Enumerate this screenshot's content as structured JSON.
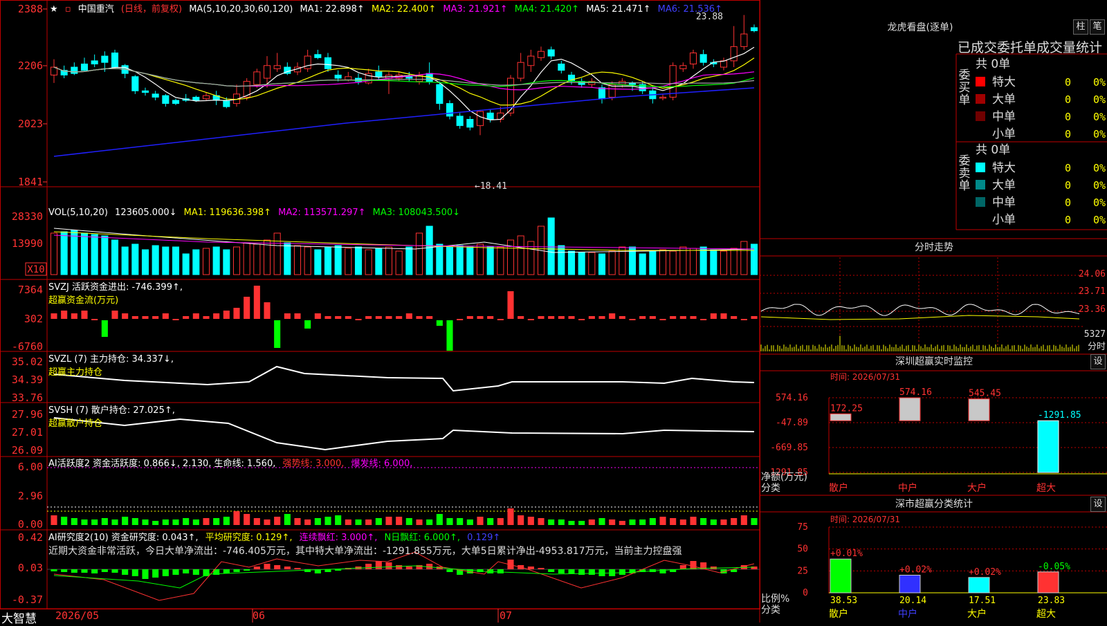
{
  "colors": {
    "up": "#ff3232",
    "down": "#00ffff",
    "ma1": "#ffffff",
    "ma2": "#ffff00",
    "ma3": "#ff00ff",
    "ma4": "#00ff00",
    "ma5": "#aaaaaa",
    "ma6": "#2020ff"
  },
  "header": {
    "stock_name": "中国重汽",
    "mode": "(日线，前复权)",
    "ma_params": "MA(5,10,20,30,60,120)",
    "ma1": "MA1: 22.898↑",
    "ma2": "MA2: 22.400↑",
    "ma3": "MA3: 21.921↑",
    "ma4": "MA4: 21.420↑",
    "ma5": "MA5: 21.471↑",
    "ma6": "MA6: 21.536↑"
  },
  "price_axis": [
    "2388",
    "2206",
    "2023",
    "1841"
  ],
  "price_high_label": "23.88",
  "price_low_label": "←18.41",
  "vol": {
    "title": "VOL(5,10,20)",
    "value": "123605.000↓",
    "ma1": "MA1: 119636.398↑",
    "ma2": "MA2: 113571.297↑",
    "ma3": "MA3: 108043.500↓",
    "axis": [
      "28330",
      "13990"
    ],
    "unit": "X10"
  },
  "svzj": {
    "title": "SVZJ  活跃资金进出: -746.399↑,",
    "subtitle": "超赢资金流(万元)",
    "axis": [
      "7364",
      "302",
      "-6760"
    ]
  },
  "svzl": {
    "title": "SVZL (7) 主力持仓: 34.337↓,",
    "subtitle": "超赢主力持仓",
    "axis": [
      "35.02",
      "34.39",
      "33.76"
    ]
  },
  "svsh": {
    "title": "SVSH (7) 散户持仓: 27.025↑,",
    "subtitle": "超赢散户持仓",
    "axis": [
      "27.96",
      "27.01",
      "26.09"
    ]
  },
  "ai_active": {
    "title": "AI活跃度2 资金活跃度: 0.866↓, 2.130, 生命线: 1.560,",
    "strong": "强势线: 3.000,",
    "burst": "爆发线: 6.000,",
    "axis": [
      "6.00",
      "2.96",
      "0.00"
    ]
  },
  "ai_research": {
    "title_a": "AI研究度2(10) 资金研究度: 0.043↑,",
    "avg": "平均研究度: 0.129↑,",
    "cons": "连续飘红: 3.000↑,",
    "nday": "N日飘红: 6.000↑,",
    "extra": "0.129↑",
    "summary": "近期大资金非常活跃，今日大单净流出：-746.405万元，其中特大单净流出：-1291.855万元，大单5日累计净出-4953.817万元，当前主力控盘强",
    "axis": [
      "0.42",
      "0.03",
      "-0.37"
    ]
  },
  "date_axis": [
    "2026/05",
    "06",
    "07"
  ],
  "brand": "大智慧",
  "right": {
    "dragon_title": "龙虎看盘(逐单)",
    "btn_bar": "柱",
    "btn_tick": "笔",
    "stats_title": "已成交委托单成交量统计",
    "buy": {
      "side": "委买单",
      "total": "共 0单",
      "rows": [
        {
          "label": "特大",
          "value": "0",
          "pct": "0%",
          "color": "#ff0000"
        },
        {
          "label": "大单",
          "value": "0",
          "pct": "0%",
          "color": "#a00000"
        },
        {
          "label": "中单",
          "value": "0",
          "pct": "0%",
          "color": "#700000"
        },
        {
          "label": "小单",
          "value": "0",
          "pct": "0%",
          "color": "#000000"
        }
      ]
    },
    "sell": {
      "side": "委卖单",
      "total": "共 0单",
      "rows": [
        {
          "label": "特大",
          "value": "0",
          "pct": "0%",
          "color": "#00ffff"
        },
        {
          "label": "大单",
          "value": "0",
          "pct": "0%",
          "color": "#008888"
        },
        {
          "label": "中单",
          "value": "0",
          "pct": "0%",
          "color": "#006666"
        },
        {
          "label": "小单",
          "value": "0",
          "pct": "0%",
          "color": "#000000"
        }
      ]
    },
    "intraday_title": "分时走势",
    "intraday_axis": [
      "24.06",
      "23.71",
      "23.36",
      "5327",
      "分时"
    ],
    "monitor_title": "深圳超赢实时监控",
    "btn_set": "设",
    "monitor_time": "时间: 2026/07/31",
    "monitor_axis": [
      "574.16",
      "-47.89",
      "-669.85",
      "-1291.85"
    ],
    "monitor_axis_label": "净额(万元)",
    "monitor_axis_label2": "分类",
    "monitor_bars": [
      {
        "cat": "散户",
        "value": 172.25,
        "label": "172.25"
      },
      {
        "cat": "中户",
        "value": 574.16,
        "label": "574.16"
      },
      {
        "cat": "大户",
        "value": 545.45,
        "label": "545.45"
      },
      {
        "cat": "超大",
        "value": -1291.85,
        "label": "-1291.85"
      }
    ],
    "class_title": "深市超赢分类统计",
    "class_time": "时间: 2026/07/31",
    "class_axis": [
      "75",
      "50",
      "25",
      "0"
    ],
    "class_axis_label": "比例%",
    "class_axis_label2": "分类",
    "class_bars": [
      {
        "cat": "散户",
        "value": 38.53,
        "label": "38.53",
        "delta": "+0.01%"
      },
      {
        "cat": "中户",
        "value": 20.14,
        "label": "20.14",
        "delta": "+0.02%"
      },
      {
        "cat": "大户",
        "value": 17.51,
        "label": "17.51",
        "delta": "+0.02%"
      },
      {
        "cat": "超大",
        "value": 23.83,
        "label": "23.83",
        "delta": "-0.05%"
      }
    ]
  }
}
